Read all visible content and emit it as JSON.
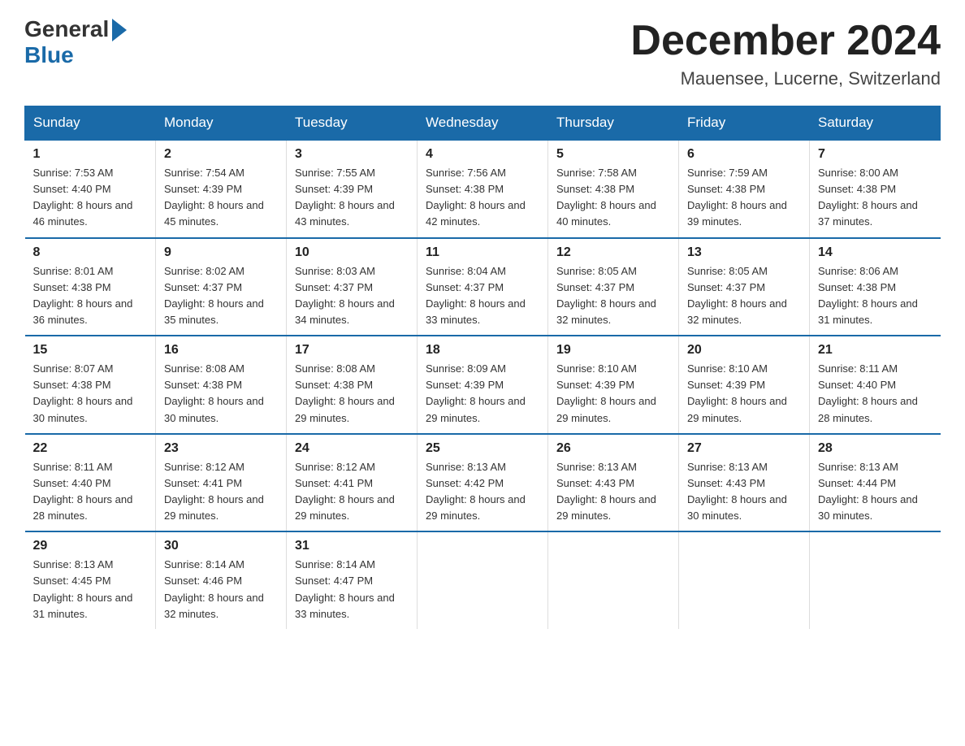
{
  "logo": {
    "general": "General",
    "blue": "Blue"
  },
  "title": "December 2024",
  "location": "Mauensee, Lucerne, Switzerland",
  "days_of_week": [
    "Sunday",
    "Monday",
    "Tuesday",
    "Wednesday",
    "Thursday",
    "Friday",
    "Saturday"
  ],
  "weeks": [
    [
      {
        "day": "1",
        "sunrise": "7:53 AM",
        "sunset": "4:40 PM",
        "daylight": "8 hours and 46 minutes."
      },
      {
        "day": "2",
        "sunrise": "7:54 AM",
        "sunset": "4:39 PM",
        "daylight": "8 hours and 45 minutes."
      },
      {
        "day": "3",
        "sunrise": "7:55 AM",
        "sunset": "4:39 PM",
        "daylight": "8 hours and 43 minutes."
      },
      {
        "day": "4",
        "sunrise": "7:56 AM",
        "sunset": "4:38 PM",
        "daylight": "8 hours and 42 minutes."
      },
      {
        "day": "5",
        "sunrise": "7:58 AM",
        "sunset": "4:38 PM",
        "daylight": "8 hours and 40 minutes."
      },
      {
        "day": "6",
        "sunrise": "7:59 AM",
        "sunset": "4:38 PM",
        "daylight": "8 hours and 39 minutes."
      },
      {
        "day": "7",
        "sunrise": "8:00 AM",
        "sunset": "4:38 PM",
        "daylight": "8 hours and 37 minutes."
      }
    ],
    [
      {
        "day": "8",
        "sunrise": "8:01 AM",
        "sunset": "4:38 PM",
        "daylight": "8 hours and 36 minutes."
      },
      {
        "day": "9",
        "sunrise": "8:02 AM",
        "sunset": "4:37 PM",
        "daylight": "8 hours and 35 minutes."
      },
      {
        "day": "10",
        "sunrise": "8:03 AM",
        "sunset": "4:37 PM",
        "daylight": "8 hours and 34 minutes."
      },
      {
        "day": "11",
        "sunrise": "8:04 AM",
        "sunset": "4:37 PM",
        "daylight": "8 hours and 33 minutes."
      },
      {
        "day": "12",
        "sunrise": "8:05 AM",
        "sunset": "4:37 PM",
        "daylight": "8 hours and 32 minutes."
      },
      {
        "day": "13",
        "sunrise": "8:05 AM",
        "sunset": "4:37 PM",
        "daylight": "8 hours and 32 minutes."
      },
      {
        "day": "14",
        "sunrise": "8:06 AM",
        "sunset": "4:38 PM",
        "daylight": "8 hours and 31 minutes."
      }
    ],
    [
      {
        "day": "15",
        "sunrise": "8:07 AM",
        "sunset": "4:38 PM",
        "daylight": "8 hours and 30 minutes."
      },
      {
        "day": "16",
        "sunrise": "8:08 AM",
        "sunset": "4:38 PM",
        "daylight": "8 hours and 30 minutes."
      },
      {
        "day": "17",
        "sunrise": "8:08 AM",
        "sunset": "4:38 PM",
        "daylight": "8 hours and 29 minutes."
      },
      {
        "day": "18",
        "sunrise": "8:09 AM",
        "sunset": "4:39 PM",
        "daylight": "8 hours and 29 minutes."
      },
      {
        "day": "19",
        "sunrise": "8:10 AM",
        "sunset": "4:39 PM",
        "daylight": "8 hours and 29 minutes."
      },
      {
        "day": "20",
        "sunrise": "8:10 AM",
        "sunset": "4:39 PM",
        "daylight": "8 hours and 29 minutes."
      },
      {
        "day": "21",
        "sunrise": "8:11 AM",
        "sunset": "4:40 PM",
        "daylight": "8 hours and 28 minutes."
      }
    ],
    [
      {
        "day": "22",
        "sunrise": "8:11 AM",
        "sunset": "4:40 PM",
        "daylight": "8 hours and 28 minutes."
      },
      {
        "day": "23",
        "sunrise": "8:12 AM",
        "sunset": "4:41 PM",
        "daylight": "8 hours and 29 minutes."
      },
      {
        "day": "24",
        "sunrise": "8:12 AM",
        "sunset": "4:41 PM",
        "daylight": "8 hours and 29 minutes."
      },
      {
        "day": "25",
        "sunrise": "8:13 AM",
        "sunset": "4:42 PM",
        "daylight": "8 hours and 29 minutes."
      },
      {
        "day": "26",
        "sunrise": "8:13 AM",
        "sunset": "4:43 PM",
        "daylight": "8 hours and 29 minutes."
      },
      {
        "day": "27",
        "sunrise": "8:13 AM",
        "sunset": "4:43 PM",
        "daylight": "8 hours and 30 minutes."
      },
      {
        "day": "28",
        "sunrise": "8:13 AM",
        "sunset": "4:44 PM",
        "daylight": "8 hours and 30 minutes."
      }
    ],
    [
      {
        "day": "29",
        "sunrise": "8:13 AM",
        "sunset": "4:45 PM",
        "daylight": "8 hours and 31 minutes."
      },
      {
        "day": "30",
        "sunrise": "8:14 AM",
        "sunset": "4:46 PM",
        "daylight": "8 hours and 32 minutes."
      },
      {
        "day": "31",
        "sunrise": "8:14 AM",
        "sunset": "4:47 PM",
        "daylight": "8 hours and 33 minutes."
      },
      {
        "day": "",
        "sunrise": "",
        "sunset": "",
        "daylight": ""
      },
      {
        "day": "",
        "sunrise": "",
        "sunset": "",
        "daylight": ""
      },
      {
        "day": "",
        "sunrise": "",
        "sunset": "",
        "daylight": ""
      },
      {
        "day": "",
        "sunrise": "",
        "sunset": "",
        "daylight": ""
      }
    ]
  ]
}
